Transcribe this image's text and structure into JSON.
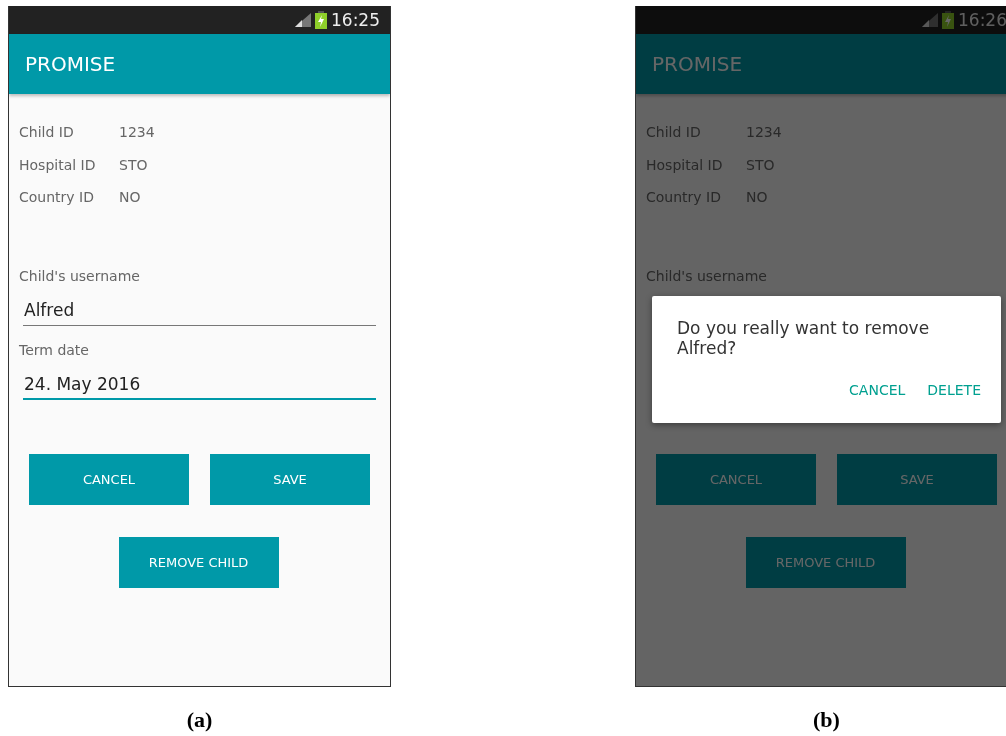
{
  "panels": [
    {
      "caption": "(a)",
      "status_bar": {
        "time": "16:25"
      },
      "app_bar": {
        "title": "PROMISE"
      },
      "info": [
        {
          "label": "Child ID",
          "value": "1234"
        },
        {
          "label": "Hospital ID",
          "value": "STO"
        },
        {
          "label": "Country ID",
          "value": "NO"
        }
      ],
      "fields": [
        {
          "label": "Child's username",
          "value": "Alfred",
          "focused": false
        },
        {
          "label": "Term date",
          "value": "24. May 2016",
          "focused": true
        }
      ],
      "buttons": [
        "CANCEL",
        "SAVE"
      ],
      "remove_button": "REMOVE CHILD"
    },
    {
      "caption": "(b)",
      "status_bar": {
        "time": "16:26"
      },
      "app_bar": {
        "title": "PROMISE"
      },
      "info": [
        {
          "label": "Child ID",
          "value": "1234"
        },
        {
          "label": "Hospital ID",
          "value": "STO"
        },
        {
          "label": "Country ID",
          "value": "NO"
        }
      ],
      "fields": [
        {
          "label": "Child's username"
        }
      ],
      "buttons": [
        "CANCEL",
        "SAVE"
      ],
      "remove_button": "REMOVE CHILD",
      "dialog": {
        "message": "Do you really want to remove Alfred?",
        "actions": [
          "CANCEL",
          "DELETE"
        ]
      }
    }
  ]
}
